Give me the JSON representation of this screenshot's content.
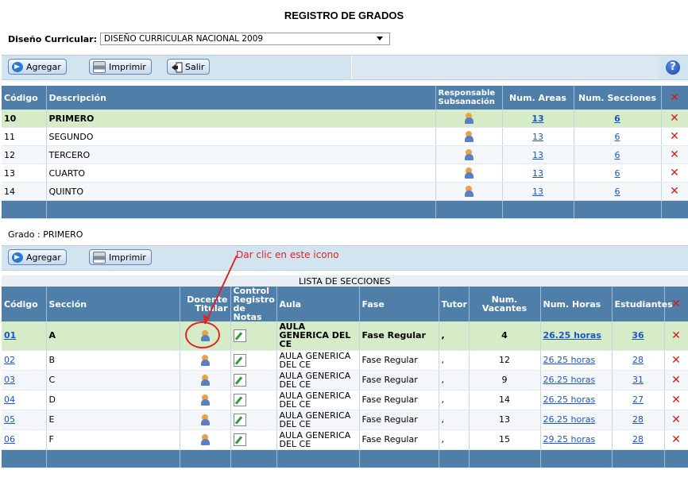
{
  "title": "REGISTRO DE GRADOS",
  "diseno": {
    "label": "Diseño Curricular:",
    "value": "DISEÑO CURRICULAR NACIONAL 2009"
  },
  "toolbar1": {
    "add": "Agregar",
    "print": "Imprimir",
    "exit": "Salir",
    "help": "?"
  },
  "grades": {
    "headers": {
      "codigo": "Código",
      "descripcion": "Descripción",
      "responsable": "Responsable Subsanación",
      "areas": "Num. Areas",
      "secciones": "Num. Secciones"
    },
    "rows": [
      {
        "codigo": "10",
        "descripcion": "PRIMERO",
        "areas": "13",
        "secciones": "6"
      },
      {
        "codigo": "11",
        "descripcion": "SEGUNDO",
        "areas": "13",
        "secciones": "6"
      },
      {
        "codigo": "12",
        "descripcion": "TERCERO",
        "areas": "13",
        "secciones": "6"
      },
      {
        "codigo": "13",
        "descripcion": "CUARTO",
        "areas": "13",
        "secciones": "6"
      },
      {
        "codigo": "14",
        "descripcion": "QUINTO",
        "areas": "13",
        "secciones": "6"
      }
    ]
  },
  "grado_label": "Grado : PRIMERO",
  "toolbar2": {
    "add": "Agregar",
    "print": "Imprimir"
  },
  "annotation": "Dar clic en este icono",
  "sections": {
    "caption": "LISTA DE SECCIONES",
    "headers": {
      "codigo": "Código",
      "seccion": "Sección",
      "docente": "Docente Titular",
      "control": "Control Registro de Notas",
      "aula": "Aula",
      "fase": "Fase",
      "tutor": "Tutor",
      "vacantes": "Num. Vacantes",
      "horas": "Num. Horas",
      "estudiantes": "Estudiantes"
    },
    "rows": [
      {
        "codigo": "01",
        "seccion": "A",
        "aula": "AULA GENERICA DEL CE",
        "fase": "Fase Regular",
        "tutor": ",",
        "vacantes": "4",
        "horas": "26.25 horas",
        "estudiantes": "36"
      },
      {
        "codigo": "02",
        "seccion": "B",
        "aula": "AULA GENERICA DEL CE",
        "fase": "Fase Regular",
        "tutor": ",",
        "vacantes": "12",
        "horas": "26.25 horas",
        "estudiantes": "28"
      },
      {
        "codigo": "03",
        "seccion": "C",
        "aula": "AULA GENERICA DEL CE",
        "fase": "Fase Regular",
        "tutor": ",",
        "vacantes": "9",
        "horas": "26.25 horas",
        "estudiantes": "31"
      },
      {
        "codigo": "04",
        "seccion": "D",
        "aula": "AULA GENERICA DEL CE",
        "fase": "Fase Regular",
        "tutor": ",",
        "vacantes": "14",
        "horas": "26.25 horas",
        "estudiantes": "27"
      },
      {
        "codigo": "05",
        "seccion": "E",
        "aula": "AULA GENERICA DEL CE",
        "fase": "Fase Regular",
        "tutor": ",",
        "vacantes": "13",
        "horas": "26.25 horas",
        "estudiantes": "28"
      },
      {
        "codigo": "06",
        "seccion": "F",
        "aula": "AULA GENERICA DEL CE",
        "fase": "Fase Regular",
        "tutor": ",",
        "vacantes": "15",
        "horas": "29.25 horas",
        "estudiantes": "28"
      }
    ]
  },
  "colors": {
    "header": "#4f7fa9",
    "selected_row": "#d6ebc8",
    "link": "#1c55c8",
    "delete": "#d21a1a",
    "annotation": "#e02424"
  }
}
